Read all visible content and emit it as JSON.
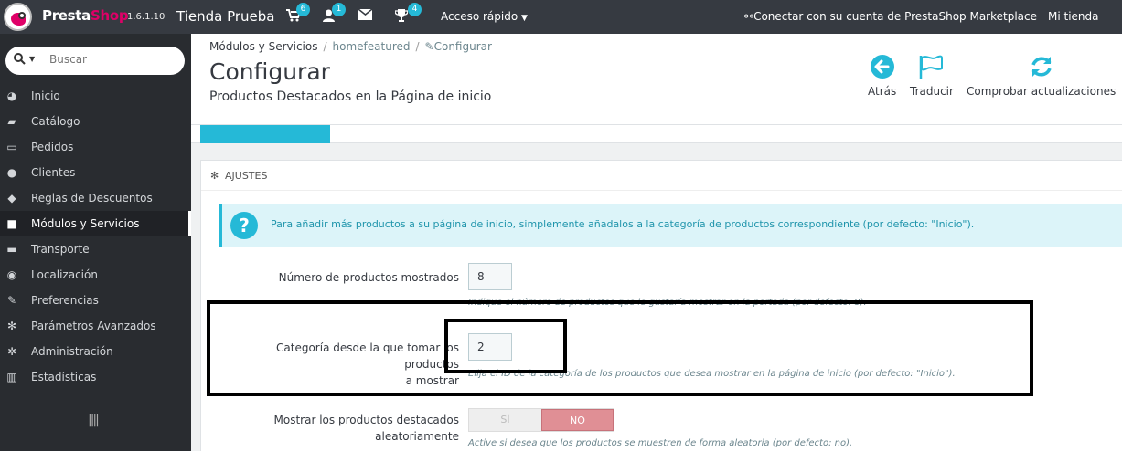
{
  "topbar": {
    "brand_presta": "Presta",
    "brand_shop": "Shop",
    "version": "1.6.1.10",
    "shop_name": "Tienda Prueba",
    "cart_badge": "6",
    "customers_badge": "1",
    "trophy_badge": "4",
    "quick_access": "Acceso rápido",
    "connect": "Conectar con su cuenta de PrestaShop Marketplace",
    "my_store": "Mi tienda"
  },
  "sidebar": {
    "search_placeholder": "Buscar",
    "items": [
      {
        "label": "Inicio",
        "icon": "tachometer-icon"
      },
      {
        "label": "Catálogo",
        "icon": "book-icon"
      },
      {
        "label": "Pedidos",
        "icon": "credit-card-icon"
      },
      {
        "label": "Clientes",
        "icon": "users-icon"
      },
      {
        "label": "Reglas de Descuentos",
        "icon": "tags-icon"
      },
      {
        "label": "Módulos y Servicios",
        "icon": "puzzle-icon"
      },
      {
        "label": "Transporte",
        "icon": "truck-icon"
      },
      {
        "label": "Localización",
        "icon": "globe-icon"
      },
      {
        "label": "Preferencias",
        "icon": "wrench-icon"
      },
      {
        "label": "Parámetros Avanzados",
        "icon": "cogs-icon"
      },
      {
        "label": "Administración",
        "icon": "cog-icon"
      },
      {
        "label": "Estadísticas",
        "icon": "bar-chart-icon"
      }
    ],
    "active_index": 5
  },
  "header": {
    "breadcrumb": {
      "item1": "Módulos y Servicios",
      "item2": "homefeatured",
      "item3": "Configurar"
    },
    "title": "Configurar",
    "subtitle": "Productos Destacados en la Página de inicio",
    "toolbar": {
      "back": "Atrás",
      "translate": "Traducir",
      "check_updates": "Comprobar actualizaciones"
    }
  },
  "panel": {
    "title": "Ajustes",
    "info": "Para añadir más productos a su página de inicio, simplemente añadalos a la categoría de productos correspondiente (por defecto: \"Inicio\").",
    "fields": {
      "nb_products": {
        "label": "Número de productos mostrados",
        "value": "8",
        "help": "Indique el número de productos que le gustaría mostrar en la portada (por defecto: 8)."
      },
      "category": {
        "label_line1": "Categoría desde la que tomar los productos",
        "label_line2": "a mostrar",
        "value": "2",
        "help": "Elija el ID de la categoría de los productos que desea mostrar en la página de inicio (por defecto: \"Inicio\")."
      },
      "random": {
        "label_line1": "Mostrar los productos destacados",
        "label_line2": "aleatoriamente",
        "yes": "SÍ",
        "no": "NO",
        "help": "Active si desea que los productos se muestren de forma aleatoria (por defecto: no)."
      }
    }
  }
}
